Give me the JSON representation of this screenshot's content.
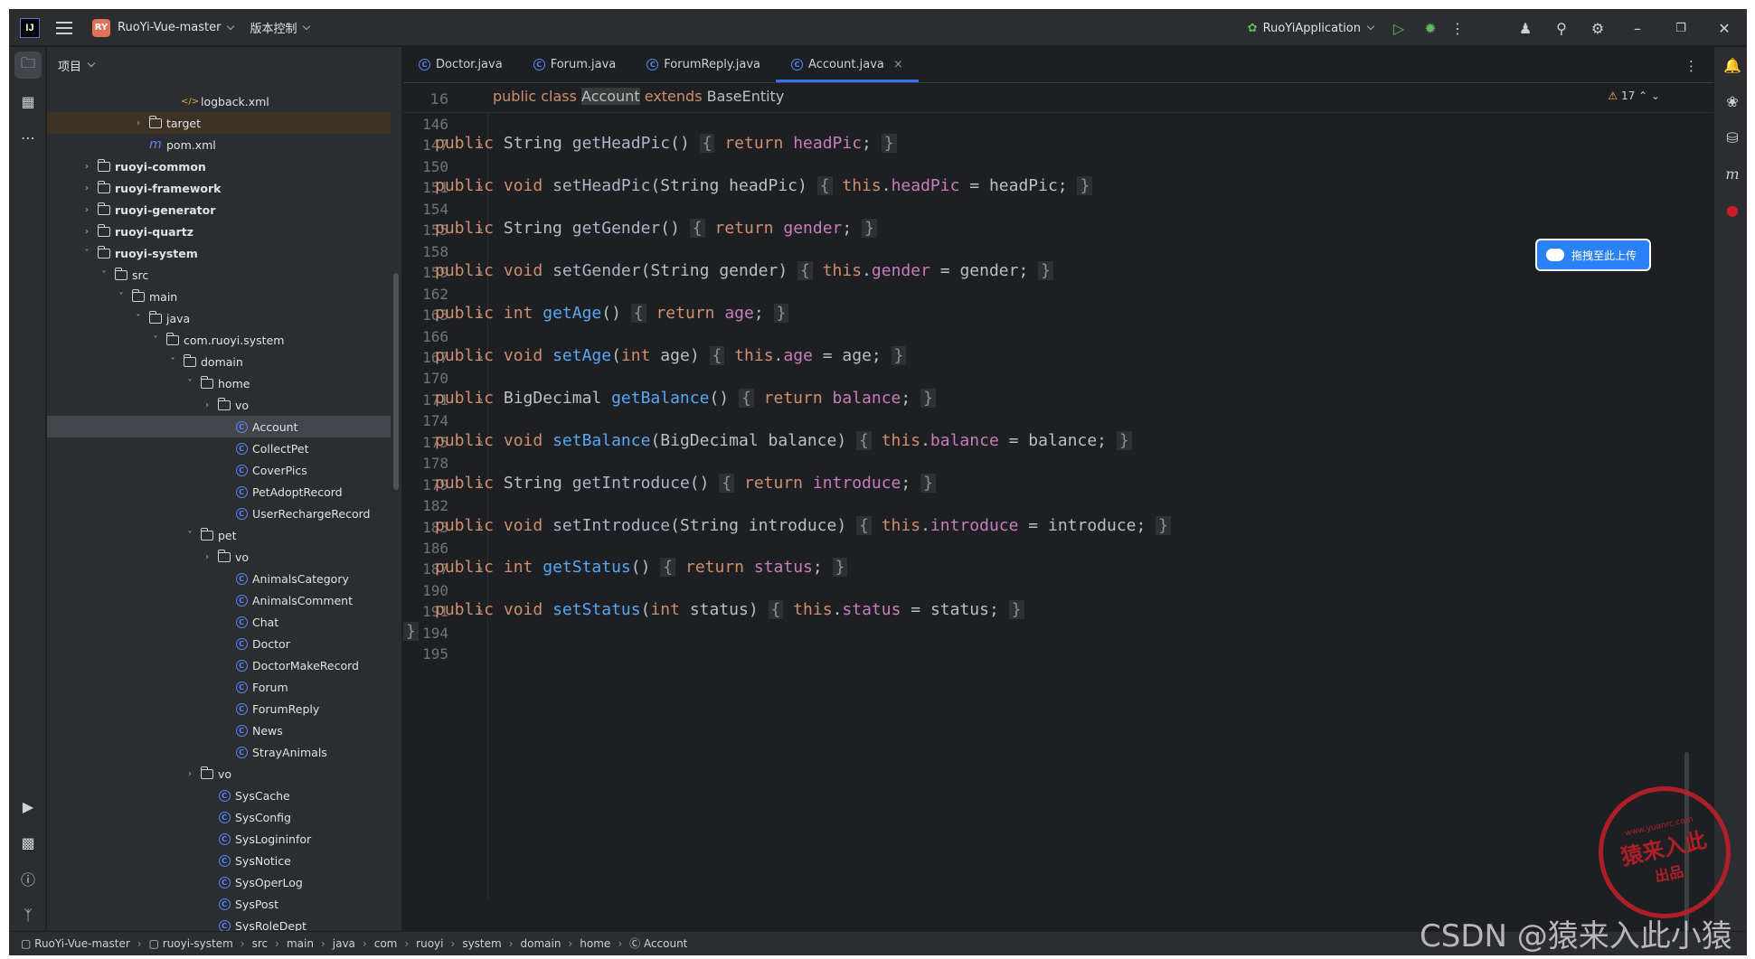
{
  "titlebar": {
    "logo": "IJ",
    "project_badge": "RY",
    "project_name": "RuoYi-Vue-master",
    "vcs": "版本控制",
    "run_config": "RuoYiApplication"
  },
  "project_panel": {
    "title": "项目",
    "tree": [
      {
        "label": "logback.xml",
        "indent": 6,
        "kind": "xml"
      },
      {
        "label": "target",
        "indent": 4,
        "kind": "folder",
        "arrow": ">"
      },
      {
        "label": "pom.xml",
        "indent": 4,
        "kind": "maven"
      },
      {
        "label": "ruoyi-common",
        "indent": 1,
        "kind": "module",
        "arrow": ">"
      },
      {
        "label": "ruoyi-framework",
        "indent": 1,
        "kind": "module",
        "arrow": ">"
      },
      {
        "label": "ruoyi-generator",
        "indent": 1,
        "kind": "module",
        "arrow": ">"
      },
      {
        "label": "ruoyi-quartz",
        "indent": 1,
        "kind": "module",
        "arrow": ">"
      },
      {
        "label": "ruoyi-system",
        "indent": 1,
        "kind": "module",
        "arrow": "v"
      },
      {
        "label": "src",
        "indent": 2,
        "kind": "folder",
        "arrow": "v"
      },
      {
        "label": "main",
        "indent": 3,
        "kind": "folder",
        "arrow": "v"
      },
      {
        "label": "java",
        "indent": 4,
        "kind": "folder",
        "arrow": "v"
      },
      {
        "label": "com.ruoyi.system",
        "indent": 5,
        "kind": "package",
        "arrow": "v"
      },
      {
        "label": "domain",
        "indent": 6,
        "kind": "package",
        "arrow": "v"
      },
      {
        "label": "home",
        "indent": 7,
        "kind": "package",
        "arrow": "v"
      },
      {
        "label": "vo",
        "indent": 8,
        "kind": "package",
        "arrow": ">"
      },
      {
        "label": "Account",
        "indent": 9,
        "kind": "class"
      },
      {
        "label": "CollectPet",
        "indent": 9,
        "kind": "class"
      },
      {
        "label": "CoverPics",
        "indent": 9,
        "kind": "class"
      },
      {
        "label": "PetAdoptRecord",
        "indent": 9,
        "kind": "class"
      },
      {
        "label": "UserRechargeRecord",
        "indent": 9,
        "kind": "class"
      },
      {
        "label": "pet",
        "indent": 7,
        "kind": "package",
        "arrow": "v"
      },
      {
        "label": "vo",
        "indent": 8,
        "kind": "package",
        "arrow": ">"
      },
      {
        "label": "AnimalsCategory",
        "indent": 9,
        "kind": "class"
      },
      {
        "label": "AnimalsComment",
        "indent": 9,
        "kind": "class"
      },
      {
        "label": "Chat",
        "indent": 9,
        "kind": "class"
      },
      {
        "label": "Doctor",
        "indent": 9,
        "kind": "class"
      },
      {
        "label": "DoctorMakeRecord",
        "indent": 9,
        "kind": "class"
      },
      {
        "label": "Forum",
        "indent": 9,
        "kind": "class"
      },
      {
        "label": "ForumReply",
        "indent": 9,
        "kind": "class"
      },
      {
        "label": "News",
        "indent": 9,
        "kind": "class"
      },
      {
        "label": "StrayAnimals",
        "indent": 9,
        "kind": "class"
      },
      {
        "label": "vo",
        "indent": 7,
        "kind": "package",
        "arrow": ">"
      },
      {
        "label": "SysCache",
        "indent": 8,
        "kind": "class"
      },
      {
        "label": "SysConfig",
        "indent": 8,
        "kind": "class"
      },
      {
        "label": "SysLogininfor",
        "indent": 8,
        "kind": "class"
      },
      {
        "label": "SysNotice",
        "indent": 8,
        "kind": "class"
      },
      {
        "label": "SysOperLog",
        "indent": 8,
        "kind": "class"
      },
      {
        "label": "SysPost",
        "indent": 8,
        "kind": "class"
      },
      {
        "label": "SysRoleDept",
        "indent": 8,
        "kind": "class"
      }
    ],
    "selected": "Account"
  },
  "tabs": [
    {
      "label": "Doctor.java",
      "active": false
    },
    {
      "label": "Forum.java",
      "active": false
    },
    {
      "label": "ForumReply.java",
      "active": false
    },
    {
      "label": "Account.java",
      "active": true
    }
  ],
  "editor": {
    "sticky_line_no": "16",
    "sticky_line": "public class Account extends BaseEntity",
    "warnings": "17",
    "lines": [
      {
        "no": "146",
        "code": ""
      },
      {
        "no": "147",
        "code": "public String getHeadPic() { return headPic; }"
      },
      {
        "no": "150",
        "code": ""
      },
      {
        "no": "151",
        "code": "public void setHeadPic(String headPic) { this.headPic = headPic; }"
      },
      {
        "no": "154",
        "code": ""
      },
      {
        "no": "155",
        "code": "public String getGender() { return gender; }"
      },
      {
        "no": "158",
        "code": ""
      },
      {
        "no": "159",
        "code": "public void setGender(String gender) { this.gender = gender; }"
      },
      {
        "no": "162",
        "code": ""
      },
      {
        "no": "163",
        "code": "public int getAge() { return age; }"
      },
      {
        "no": "166",
        "code": ""
      },
      {
        "no": "167",
        "code": "public void setAge(int age) { this.age = age; }"
      },
      {
        "no": "170",
        "code": ""
      },
      {
        "no": "171",
        "code": "public BigDecimal getBalance() { return balance; }"
      },
      {
        "no": "174",
        "code": ""
      },
      {
        "no": "175",
        "code": "public void setBalance(BigDecimal balance) { this.balance = balance; }"
      },
      {
        "no": "178",
        "code": ""
      },
      {
        "no": "179",
        "code": "public String getIntroduce() { return introduce; }"
      },
      {
        "no": "182",
        "code": ""
      },
      {
        "no": "183",
        "code": "public void setIntroduce(String introduce) { this.introduce = introduce; }"
      },
      {
        "no": "186",
        "code": ""
      },
      {
        "no": "187",
        "code": "public int getStatus() { return status; }"
      },
      {
        "no": "190",
        "code": ""
      },
      {
        "no": "191",
        "code": "public void setStatus(int status) { this.status = status; }"
      },
      {
        "no": "194",
        "code": "}"
      },
      {
        "no": "195",
        "code": ""
      }
    ]
  },
  "upload_button": "拖拽至此上传",
  "breadcrumb": [
    "RuoYi-Vue-master",
    "ruoyi-system",
    "src",
    "main",
    "java",
    "com",
    "ruoyi",
    "system",
    "domain",
    "home",
    "Account"
  ],
  "stamp": {
    "text": "猿来入此",
    "sub": "出品",
    "url": "www.yuanrc.com"
  },
  "watermark": "CSDN @猿来入此小猿",
  "colors": {
    "background": "#1e1f22",
    "panel": "#2b2d30",
    "keyword": "#cf8e6d",
    "function": "#56a8f5",
    "field": "#c77dbb",
    "accent": "#3574f0"
  }
}
